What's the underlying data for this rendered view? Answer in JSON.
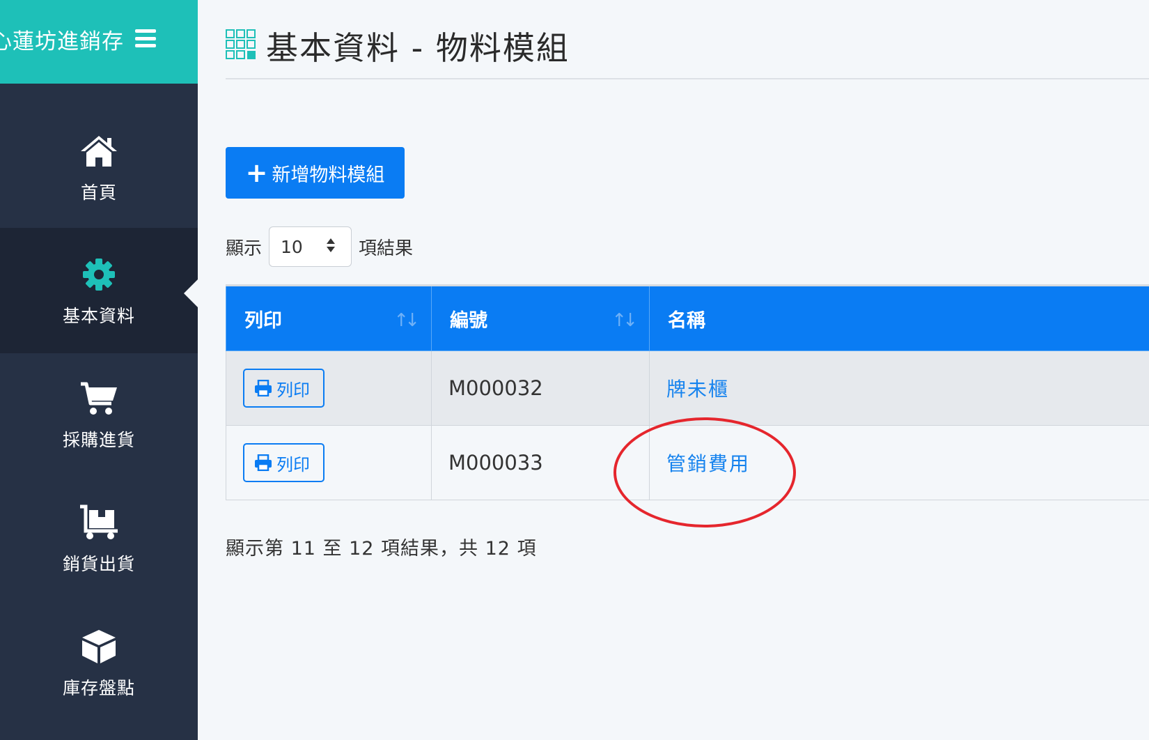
{
  "app": {
    "brand": "心蓮坊進銷存"
  },
  "sidebar": {
    "items": [
      {
        "label": "首頁",
        "icon": "home-icon"
      },
      {
        "label": "基本資料",
        "icon": "gear-icon",
        "active": true
      },
      {
        "label": "採購進貨",
        "icon": "shopping-cart-icon"
      },
      {
        "label": "銷貨出貨",
        "icon": "dolly-cart-icon"
      },
      {
        "label": "庫存盤點",
        "icon": "box-icon"
      }
    ]
  },
  "header": {
    "title": "基本資料 - 物料模組",
    "icon": "grid-icon"
  },
  "toolbar": {
    "add_label": "新增物料模組",
    "add_icon": "plus-icon"
  },
  "page_length": {
    "prefix": "顯示",
    "value": "10",
    "suffix": "項結果"
  },
  "table": {
    "columns": [
      {
        "label": "列印",
        "sortable": true
      },
      {
        "label": "編號",
        "sortable": true
      },
      {
        "label": "名稱",
        "sortable": false
      }
    ],
    "rows": [
      {
        "print_label": "列印",
        "code": "M000032",
        "name": "牌未櫃"
      },
      {
        "print_label": "列印",
        "code": "M000033",
        "name": "管銷費用"
      }
    ]
  },
  "info": {
    "text": "顯示第 11 至 12 項結果，共 12 項"
  },
  "colors": {
    "brand": "#1ec0b8",
    "sidebar": "#263145",
    "primary": "#0a7cf3",
    "annotation": "#e5262d"
  }
}
